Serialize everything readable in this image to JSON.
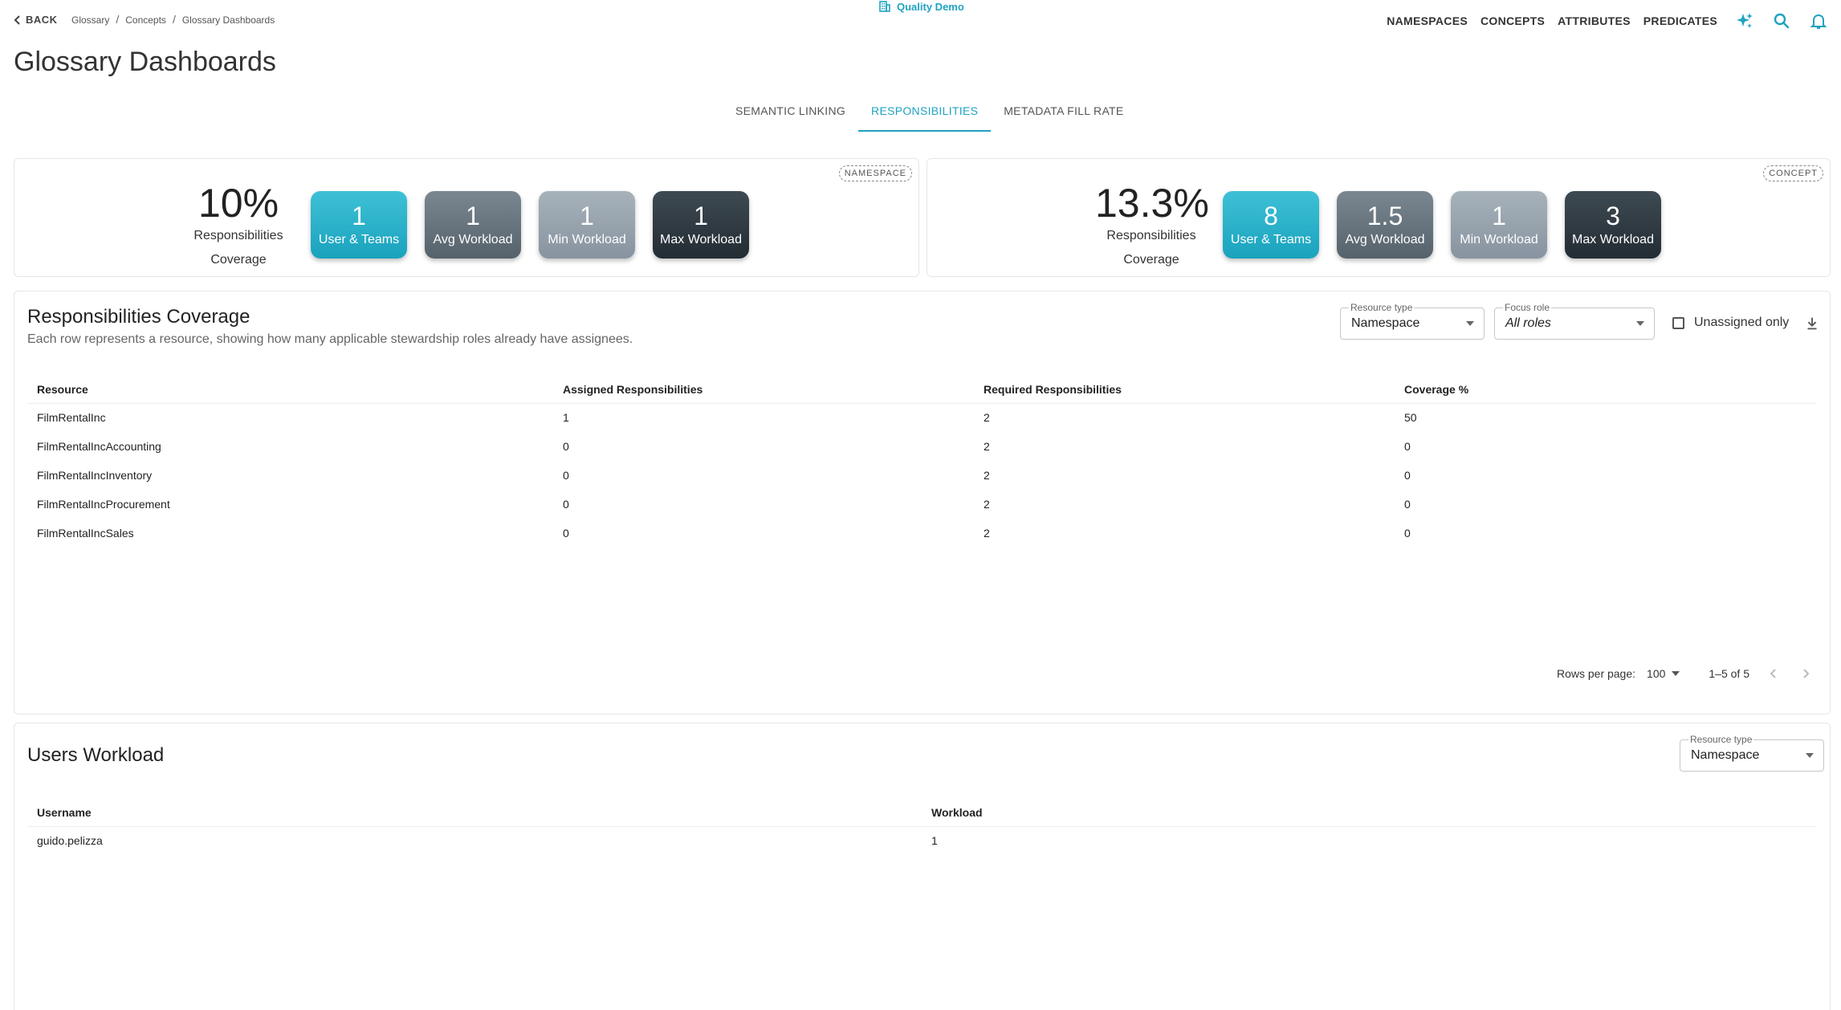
{
  "nav": {
    "back_label": "BACK",
    "breadcrumb": [
      "Glossary",
      "Concepts",
      "Glossary Dashboards"
    ],
    "workspace": "Quality Demo",
    "links": [
      "NAMESPACES",
      "CONCEPTS",
      "ATTRIBUTES",
      "PREDICATES"
    ],
    "icons": [
      "sparkle-icon",
      "search-icon",
      "bell-icon"
    ]
  },
  "page_title": "Glossary Dashboards",
  "tabs": [
    {
      "label": "SEMANTIC LINKING",
      "active": false
    },
    {
      "label": "RESPONSIBILITIES",
      "active": true
    },
    {
      "label": "METADATA FILL RATE",
      "active": false
    }
  ],
  "summaries": [
    {
      "scope": "NAMESPACE",
      "coverage": "10%",
      "coverage_label_1": "Responsibilities",
      "coverage_label_2": "Coverage",
      "tiles": [
        {
          "value": "1",
          "label": "User & Teams"
        },
        {
          "value": "1",
          "label": "Avg Workload"
        },
        {
          "value": "1",
          "label": "Min Workload"
        },
        {
          "value": "1",
          "label": "Max Workload"
        }
      ]
    },
    {
      "scope": "CONCEPT",
      "coverage": "13.3%",
      "coverage_label_1": "Responsibilities",
      "coverage_label_2": "Coverage",
      "tiles": [
        {
          "value": "8",
          "label": "User & Teams"
        },
        {
          "value": "1.5",
          "label": "Avg Workload"
        },
        {
          "value": "1",
          "label": "Min Workload"
        },
        {
          "value": "3",
          "label": "Max Workload"
        }
      ]
    }
  ],
  "coverage_panel": {
    "title": "Responsibilities Coverage",
    "subtitle": "Each row represents a resource, showing how many applicable stewardship roles already have assignees.",
    "resource_type_label": "Resource type",
    "resource_type_value": "Namespace",
    "focus_role_label": "Focus role",
    "focus_role_value": "All roles",
    "unassigned_only_label": "Unassigned only",
    "columns": [
      "Resource",
      "Assigned Responsibilities",
      "Required Responsibilities",
      "Coverage %"
    ],
    "rows": [
      [
        "FilmRentalInc",
        "1",
        "2",
        "50"
      ],
      [
        "FilmRentalIncAccounting",
        "0",
        "2",
        "0"
      ],
      [
        "FilmRentalIncInventory",
        "0",
        "2",
        "0"
      ],
      [
        "FilmRentalIncProcurement",
        "0",
        "2",
        "0"
      ],
      [
        "FilmRentalIncSales",
        "0",
        "2",
        "0"
      ]
    ],
    "rows_per_page_label": "Rows per page:",
    "rows_per_page_value": "100",
    "range_text": "1–5 of 5"
  },
  "workload_panel": {
    "title": "Users Workload",
    "resource_type_label": "Resource type",
    "resource_type_value": "Namespace",
    "columns": [
      "Username",
      "Workload"
    ],
    "rows": [
      [
        "guido.pelizza",
        "1"
      ]
    ]
  },
  "colors": {
    "accent": "#1fa3c0",
    "tile_users": "#2bb3ca",
    "tile_avg": "#66737c",
    "tile_min": "#97a3ad",
    "tile_max": "#2e3940"
  }
}
